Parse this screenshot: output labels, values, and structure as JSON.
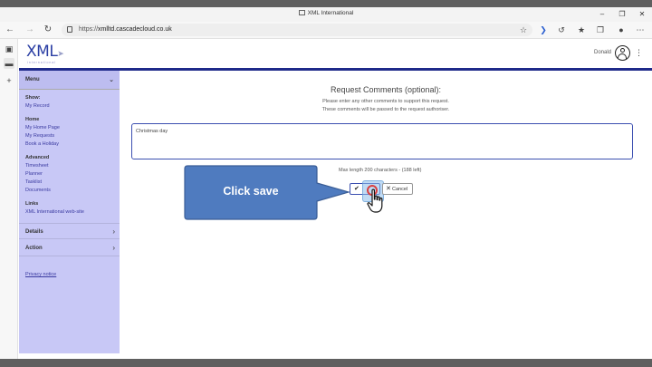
{
  "window": {
    "title": "XML International"
  },
  "browser": {
    "url_prefix": "https://",
    "url_host": "xmlltd.cascadecloud.co.uk"
  },
  "header": {
    "logo_text": "XML",
    "logo_subtext": "international",
    "user_name": "Donald"
  },
  "menu": {
    "title": "Menu",
    "sections": [
      {
        "heading": "Show:",
        "items": [
          "My Record"
        ]
      },
      {
        "heading": "Home",
        "items": [
          "My Home Page",
          "My Requests",
          "Book a Holiday"
        ]
      },
      {
        "heading": "Advanced",
        "items": [
          "Timesheet",
          "Planner",
          "Tasklist",
          "Documents"
        ]
      },
      {
        "heading": "Links",
        "items": [
          "XML International web-site"
        ]
      }
    ],
    "rows": [
      "Details",
      "Action"
    ],
    "privacy_link": "Privacy notice"
  },
  "main": {
    "title": "Request Comments (optional):",
    "subtitle_1": "Please enter any other comments to support this request.",
    "subtitle_2": "These comments will be passed to the request authoriser.",
    "comment_value": "Christmas day",
    "max_length_text": "Max length 200 characters - (188 left)",
    "cancel_label": "Cancel"
  },
  "callout": {
    "text": "Click save",
    "fill_color": "#4f7bbf",
    "border_color": "#3a5d96"
  },
  "colors": {
    "menu_bg": "#c8c8f6",
    "header_rule": "#1f2a8a",
    "accent": "#3b4fb0"
  }
}
